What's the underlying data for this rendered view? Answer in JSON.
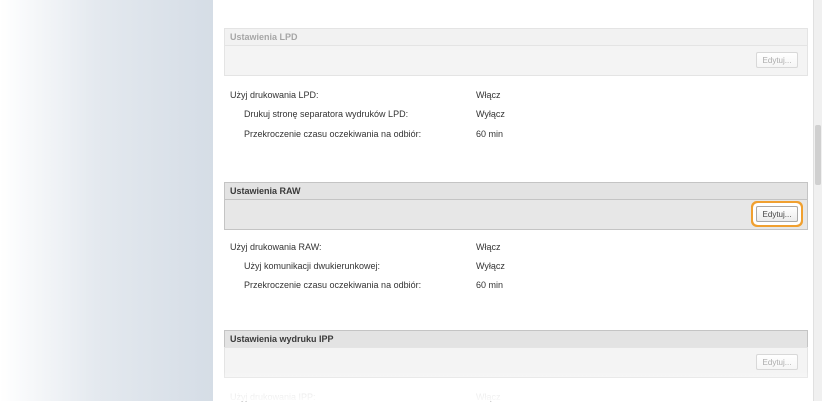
{
  "sections": {
    "lpd": {
      "title": "Ustawienia LPD",
      "edit_label": "Edytuj...",
      "rows": [
        {
          "label": "Użyj drukowania LPD:",
          "value": "Włącz"
        },
        {
          "label": "Drukuj stronę separatora wydruków LPD:",
          "value": "Wyłącz"
        },
        {
          "label": "Przekroczenie czasu oczekiwania na odbiór:",
          "value": "60 min"
        }
      ]
    },
    "raw": {
      "title": "Ustawienia RAW",
      "edit_label": "Edytuj...",
      "rows": [
        {
          "label": "Użyj drukowania RAW:",
          "value": "Włącz"
        },
        {
          "label": "Użyj komunikacji dwukierunkowej:",
          "value": "Wyłącz"
        },
        {
          "label": "Przekroczenie czasu oczekiwania na odbiór:",
          "value": "60 min"
        }
      ]
    },
    "ipp": {
      "title": "Ustawienia wydruku IPP",
      "edit_label": "Edytuj...",
      "rows": [
        {
          "label": "Użyj drukowania IPP:",
          "value": "Włącz"
        }
      ]
    }
  },
  "colors": {
    "highlight": "#f0a030",
    "header_bg": "#e3e3e3"
  }
}
